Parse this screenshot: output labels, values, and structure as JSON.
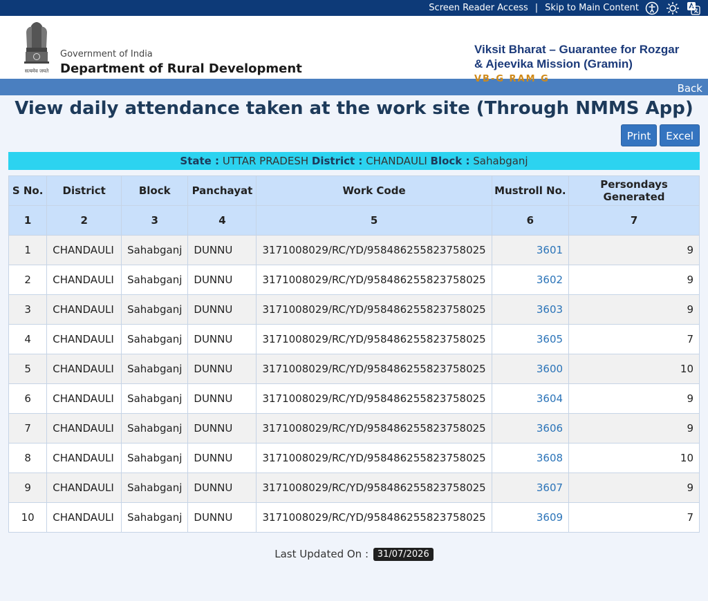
{
  "topbar": {
    "screen_reader": "Screen Reader Access",
    "separator": "|",
    "skip": "Skip to Main Content"
  },
  "header": {
    "emblem_caption": "सत्यमेव जयते",
    "gov": "Government of India",
    "dept": "Department of Rural Development",
    "scheme_line1": "Viksit Bharat – Guarantee for Rozgar",
    "scheme_line2": "& Ajeevika Mission (Gramin)",
    "scheme_line3": "VB-G RAM G"
  },
  "nav": {
    "back": "Back"
  },
  "title": "View daily attendance taken at the work site (Through NMMS App)",
  "buttons": {
    "print": "Print",
    "excel": "Excel"
  },
  "info": {
    "state_label": "State :",
    "state": "UTTAR PRADESH",
    "district_label": "District :",
    "district": "CHANDAULI",
    "block_label": "Block :",
    "block": "Sahabganj"
  },
  "table": {
    "headers": [
      "S No.",
      "District",
      "Block",
      "Panchayat",
      "Work Code",
      "Mustroll No.",
      "Persondays Generated"
    ],
    "numbers": [
      "1",
      "2",
      "3",
      "4",
      "5",
      "6",
      "7"
    ],
    "rows": [
      [
        "1",
        "CHANDAULI",
        "Sahabganj",
        "DUNNU",
        "3171008029/RC/YD/958486255823758025",
        "3601",
        "9"
      ],
      [
        "2",
        "CHANDAULI",
        "Sahabganj",
        "DUNNU",
        "3171008029/RC/YD/958486255823758025",
        "3602",
        "9"
      ],
      [
        "3",
        "CHANDAULI",
        "Sahabganj",
        "DUNNU",
        "3171008029/RC/YD/958486255823758025",
        "3603",
        "9"
      ],
      [
        "4",
        "CHANDAULI",
        "Sahabganj",
        "DUNNU",
        "3171008029/RC/YD/958486255823758025",
        "3605",
        "7"
      ],
      [
        "5",
        "CHANDAULI",
        "Sahabganj",
        "DUNNU",
        "3171008029/RC/YD/958486255823758025",
        "3600",
        "10"
      ],
      [
        "6",
        "CHANDAULI",
        "Sahabganj",
        "DUNNU",
        "3171008029/RC/YD/958486255823758025",
        "3604",
        "9"
      ],
      [
        "7",
        "CHANDAULI",
        "Sahabganj",
        "DUNNU",
        "3171008029/RC/YD/958486255823758025",
        "3606",
        "9"
      ],
      [
        "8",
        "CHANDAULI",
        "Sahabganj",
        "DUNNU",
        "3171008029/RC/YD/958486255823758025",
        "3608",
        "10"
      ],
      [
        "9",
        "CHANDAULI",
        "Sahabganj",
        "DUNNU",
        "3171008029/RC/YD/958486255823758025",
        "3607",
        "9"
      ],
      [
        "10",
        "CHANDAULI",
        "Sahabganj",
        "DUNNU",
        "3171008029/RC/YD/958486255823758025",
        "3609",
        "7"
      ]
    ]
  },
  "footer": {
    "label": "Last Updated On :",
    "date": "31/07/2026"
  },
  "colors": {
    "topbar": "#0d3a78",
    "navbar": "#4a7fc0",
    "infobar": "#2cd3f0",
    "header_row": "#c9e0fb",
    "link": "#2a73b8"
  }
}
